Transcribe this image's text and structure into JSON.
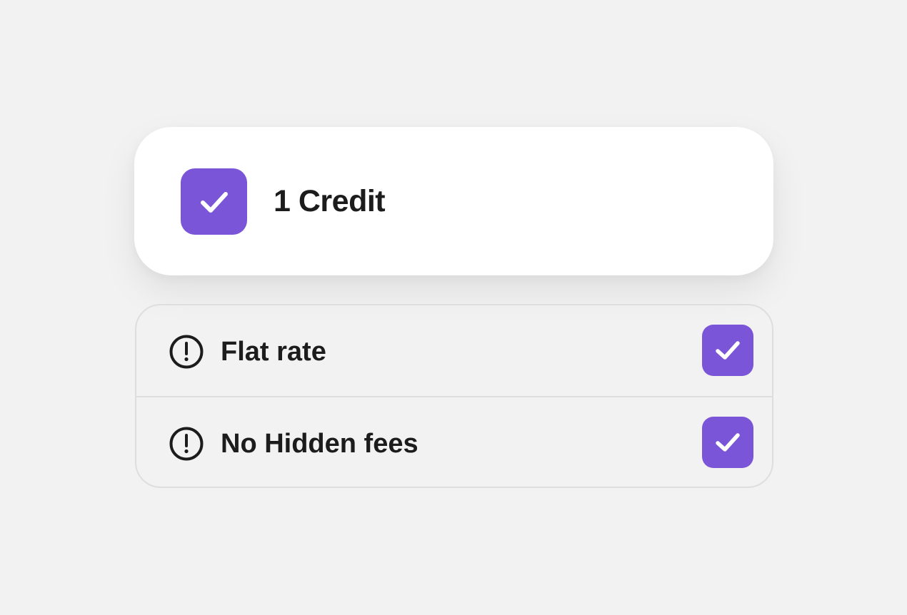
{
  "colors": {
    "background": "#f2f2f2",
    "card": "#ffffff",
    "accent": "#7b55d8",
    "text": "#1c1c1c",
    "border": "#dedede"
  },
  "credit_option": {
    "label": "1 Credit",
    "checked": true,
    "icon": "checkmark-icon"
  },
  "features": [
    {
      "label": "Flat rate",
      "info_icon": "exclamation-circle-icon",
      "checked": true
    },
    {
      "label": "No Hidden fees",
      "info_icon": "exclamation-circle-icon",
      "checked": true
    }
  ]
}
